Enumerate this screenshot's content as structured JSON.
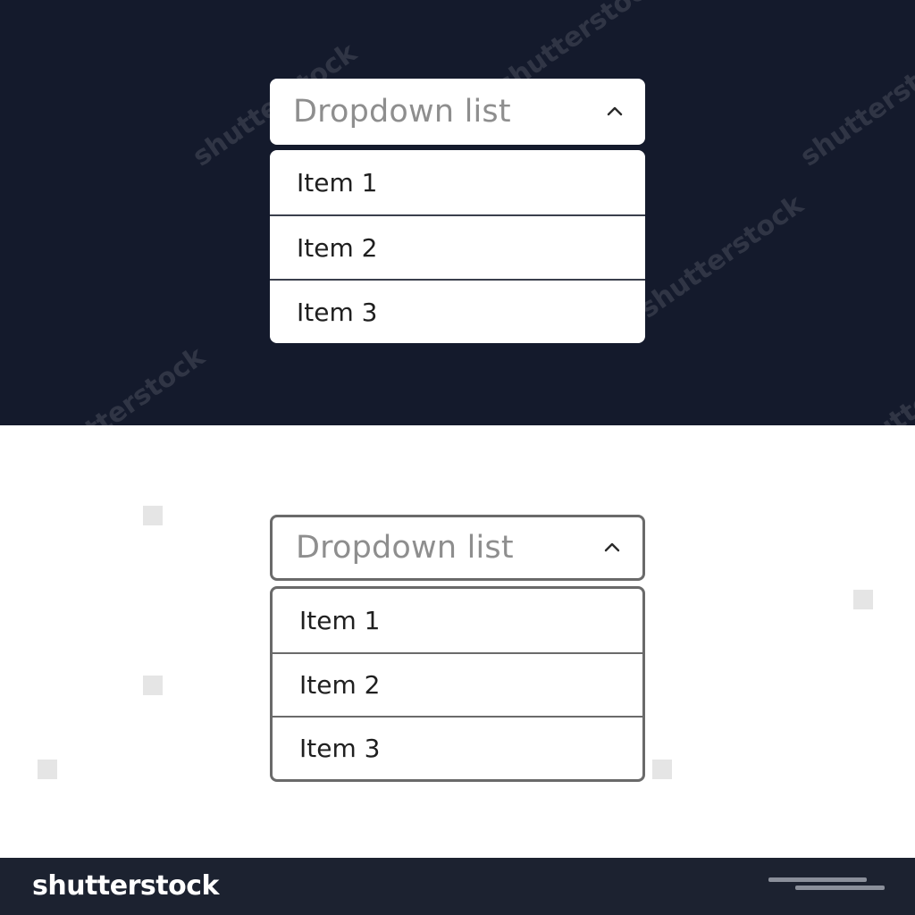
{
  "dropdowns": [
    {
      "theme": "dark",
      "title": "Dropdown list",
      "items": [
        "Item 1",
        "Item 2",
        "Item 3"
      ]
    },
    {
      "theme": "light",
      "title": "Dropdown list",
      "items": [
        "Item 1",
        "Item 2",
        "Item 3"
      ]
    }
  ],
  "footer": {
    "brand": "shutterstock"
  },
  "watermark": {
    "text": "shutterstock"
  },
  "colors": {
    "dark_bg": "#141a2c",
    "light_bg": "#ffffff",
    "border": "#6a6a6a",
    "placeholder_text": "#8e8e8e",
    "item_text": "#1f1f1f"
  },
  "icons": {
    "chevron": "chevron-up-icon"
  }
}
